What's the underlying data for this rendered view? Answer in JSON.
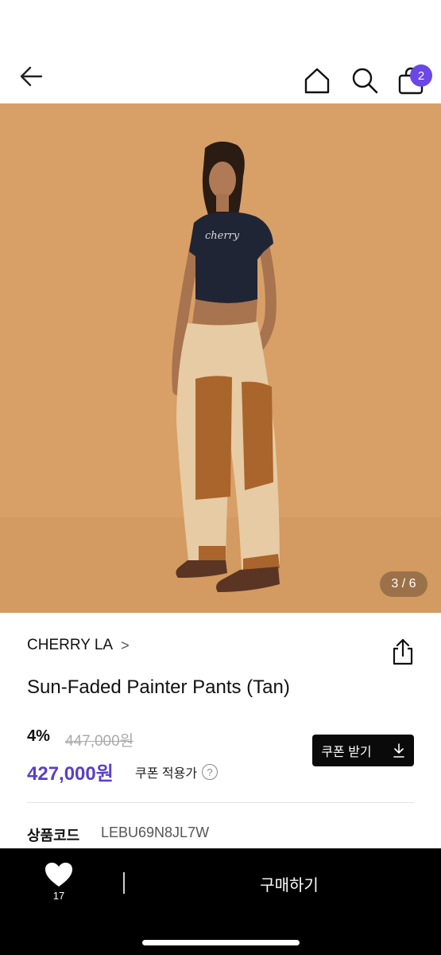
{
  "header": {
    "icons": [
      "back-arrow-icon",
      "home-icon",
      "search-icon",
      "shopping-bag-icon"
    ],
    "cart_count": "2"
  },
  "gallery": {
    "pager": "3 / 6",
    "colors": {
      "background": "#d79f66"
    }
  },
  "product": {
    "brand": "CHERRY LA",
    "brand_chevron": ">",
    "title": "Sun-Faded Painter Pants (Tan)",
    "discount": "4%",
    "original_price": "447,000원",
    "price": "427,000원",
    "coupon_applicable": "쿠폰 적용가",
    "help_glyph": "?",
    "coupon_button": "쿠폰 받기",
    "code_label": "상품코드",
    "code_value": "LEBU69N8JL7W"
  },
  "bottom": {
    "like_count": "17",
    "buy_label": "구매하기"
  },
  "colors": {
    "accent": "#6a47e6",
    "price": "#5a3fc7",
    "bar": "#000000"
  }
}
